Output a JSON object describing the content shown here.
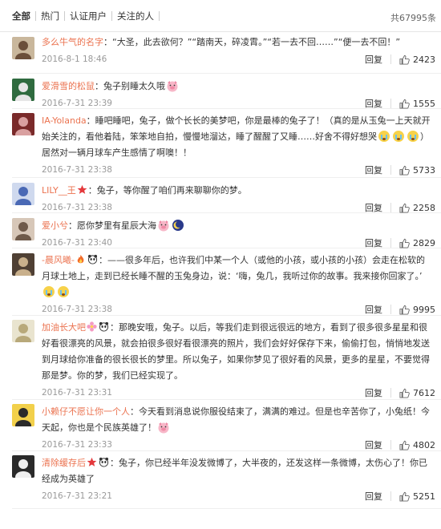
{
  "tabs": [
    {
      "label": "全部",
      "active": true
    },
    {
      "label": "热门",
      "active": false
    },
    {
      "label": "认证用户",
      "active": false
    },
    {
      "label": "关注的人",
      "active": false
    }
  ],
  "total": "共67995条",
  "reply_label": "回复",
  "comments": [
    {
      "user": "多么牛气的名字",
      "badges": [],
      "sep": "：",
      "text": "“大圣，此去欲何？”“踏南天，碎凌霄。”“若一去不回……”“便一去不回！”",
      "emojis": [],
      "time": "2016-8-1 18:46",
      "likes": "2423",
      "avatar": "avatar-1"
    },
    {
      "user": "爱滑雪的松鼠",
      "badges": [],
      "sep": "：",
      "text": "兔子别睡太久哦",
      "emojis": [
        "pig"
      ],
      "time": "2016-7-31 23:39",
      "likes": "1555",
      "avatar": "avatar-2"
    },
    {
      "user": "IA-Yolanda",
      "badges": [],
      "sep": "：",
      "text": "睡吧睡吧，兔子，做个长长的美梦吧，你是最棒的兔子了！（真的是从玉兔一上天就开始关注的，看他着陆，笨笨地自拍，慢慢地溜达，睡了醒醒了又睡……好舍不得好想哭",
      "emojis": [
        "cry",
        "cry",
        "cry"
      ],
      "text2": "）居然对一辆月球车产生感情了啊噢！！",
      "time": "2016-7-31 23:38",
      "likes": "5733",
      "avatar": "avatar-3"
    },
    {
      "user": "LILY__王",
      "badges": [
        "star"
      ],
      "sep": "：",
      "text": "兔子，等你醒了咱们再来聊聊你的梦。",
      "emojis": [],
      "time": "2016-7-31 23:38",
      "likes": "2258",
      "avatar": "avatar-4"
    },
    {
      "user": "爱小兮",
      "badges": [],
      "sep": "：",
      "text": "愿你梦里有星辰大海",
      "emojis": [
        "pig",
        "moon"
      ],
      "time": "2016-7-31 23:40",
      "likes": "2829",
      "avatar": "avatar-5"
    },
    {
      "user": "-晨风曦-",
      "badges": [
        "fire",
        "panda"
      ],
      "sep": "：",
      "text": "——很多年后，也许我们中某一个人（或他的小孩，或小孩的小孩）会走在松软的月球土地上，走到已经长睡不醒的玉兔身边，说：‘嗨，兔几，我听过你的故事。我来接你回家了。’",
      "emojis": [
        "cry",
        "cry"
      ],
      "time": "2016-7-31 23:38",
      "likes": "9995",
      "avatar": "avatar-6"
    },
    {
      "user": "加油长大吧",
      "badges": [
        "flower",
        "panda"
      ],
      "sep": "：",
      "text": "那晚安哦，兔子。以后，等我们走到很远很远的地方，看到了很多很多星星和很好看很漂亮的风景，就会拍很多很好看很漂亮的照片，我们会好好保存下来，偷偷打包，悄悄地发送到月球给你准备的很长很长的梦里。所以兔子，如果你梦见了很好看的风景，更多的星星，不要觉得那是梦。你的梦，我们已经实现了。",
      "emojis": [],
      "time": "2016-7-31 23:31",
      "likes": "7612",
      "avatar": "avatar-7"
    },
    {
      "user": "小赖仔不愿让你一个人",
      "badges": [],
      "sep": "：",
      "text": "今天看到消息说你服役结束了，满满的难过。但是也辛苦你了，小兔纸！今天起，你也是个民族英雄了！",
      "emojis": [
        "pig"
      ],
      "time": "2016-7-31 23:33",
      "likes": "4802",
      "avatar": "avatar-8"
    },
    {
      "user": "清除缓存后",
      "badges": [
        "star",
        "panda"
      ],
      "sep": "：",
      "text": "兔子，你已经半年没发微博了，大半夜的，还发这样一条微博，太伤心了！你已经成为英雄了",
      "emojis": [],
      "time": "2016-7-31 23:21",
      "likes": "5251",
      "avatar": "avatar-9"
    }
  ]
}
